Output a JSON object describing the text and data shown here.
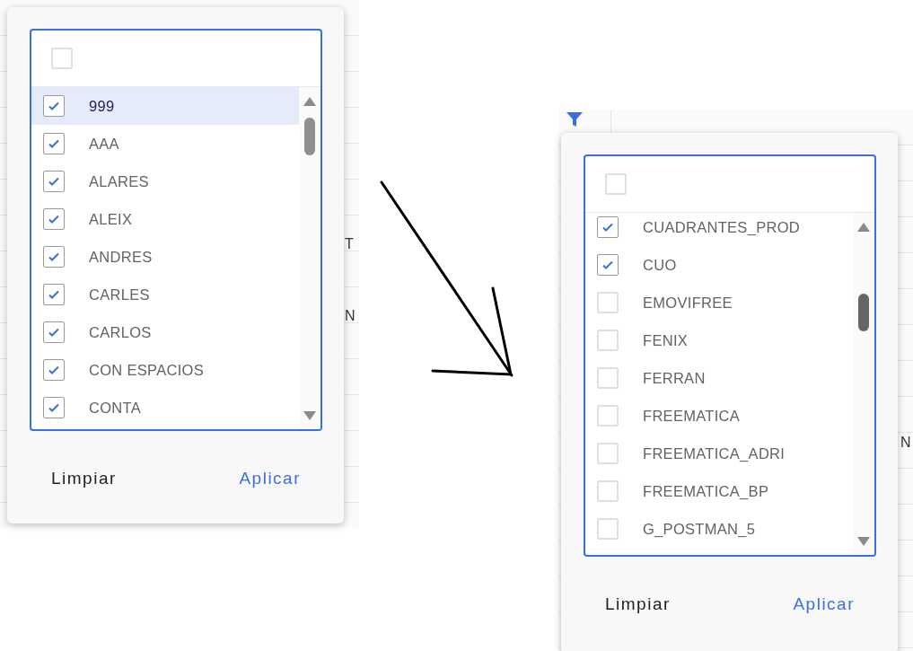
{
  "panels": [
    {
      "select_all": {
        "checked": false
      },
      "items": [
        {
          "label": "999",
          "checked": true,
          "selected": true
        },
        {
          "label": "AAA",
          "checked": true,
          "selected": false
        },
        {
          "label": "ALARES",
          "checked": true,
          "selected": false
        },
        {
          "label": "ALEIX",
          "checked": true,
          "selected": false
        },
        {
          "label": "ANDRES",
          "checked": true,
          "selected": false
        },
        {
          "label": "CARLES",
          "checked": true,
          "selected": false
        },
        {
          "label": "CARLOS",
          "checked": true,
          "selected": false
        },
        {
          "label": "CON ESPACIOS",
          "checked": true,
          "selected": false
        },
        {
          "label": "CONTA",
          "checked": true,
          "selected": false
        }
      ],
      "buttons": [
        {
          "label": "Limpiar",
          "kind": "plain"
        },
        {
          "label": "Aplicar",
          "kind": "primary"
        }
      ],
      "background_texts": [
        "T",
        "N"
      ]
    },
    {
      "filter_icon": true,
      "select_all": {
        "checked": false
      },
      "items": [
        {
          "label": "CUADRANTES_PROD",
          "checked": true,
          "selected": false
        },
        {
          "label": "CUO",
          "checked": true,
          "selected": false
        },
        {
          "label": "EMOVIFREE",
          "checked": false,
          "selected": false
        },
        {
          "label": "FENIX",
          "checked": false,
          "selected": false
        },
        {
          "label": "FERRAN",
          "checked": false,
          "selected": false
        },
        {
          "label": "FREEMATICA",
          "checked": false,
          "selected": false
        },
        {
          "label": "FREEMATICA_ADRI",
          "checked": false,
          "selected": false
        },
        {
          "label": "FREEMATICA_BP",
          "checked": false,
          "selected": false
        },
        {
          "label": "G_POSTMAN_5",
          "checked": false,
          "selected": false
        }
      ],
      "buttons": [
        {
          "label": "Limpiar",
          "kind": "plain"
        },
        {
          "label": "Aplicar",
          "kind": "primary"
        }
      ],
      "background_texts": [
        "N"
      ]
    }
  ]
}
